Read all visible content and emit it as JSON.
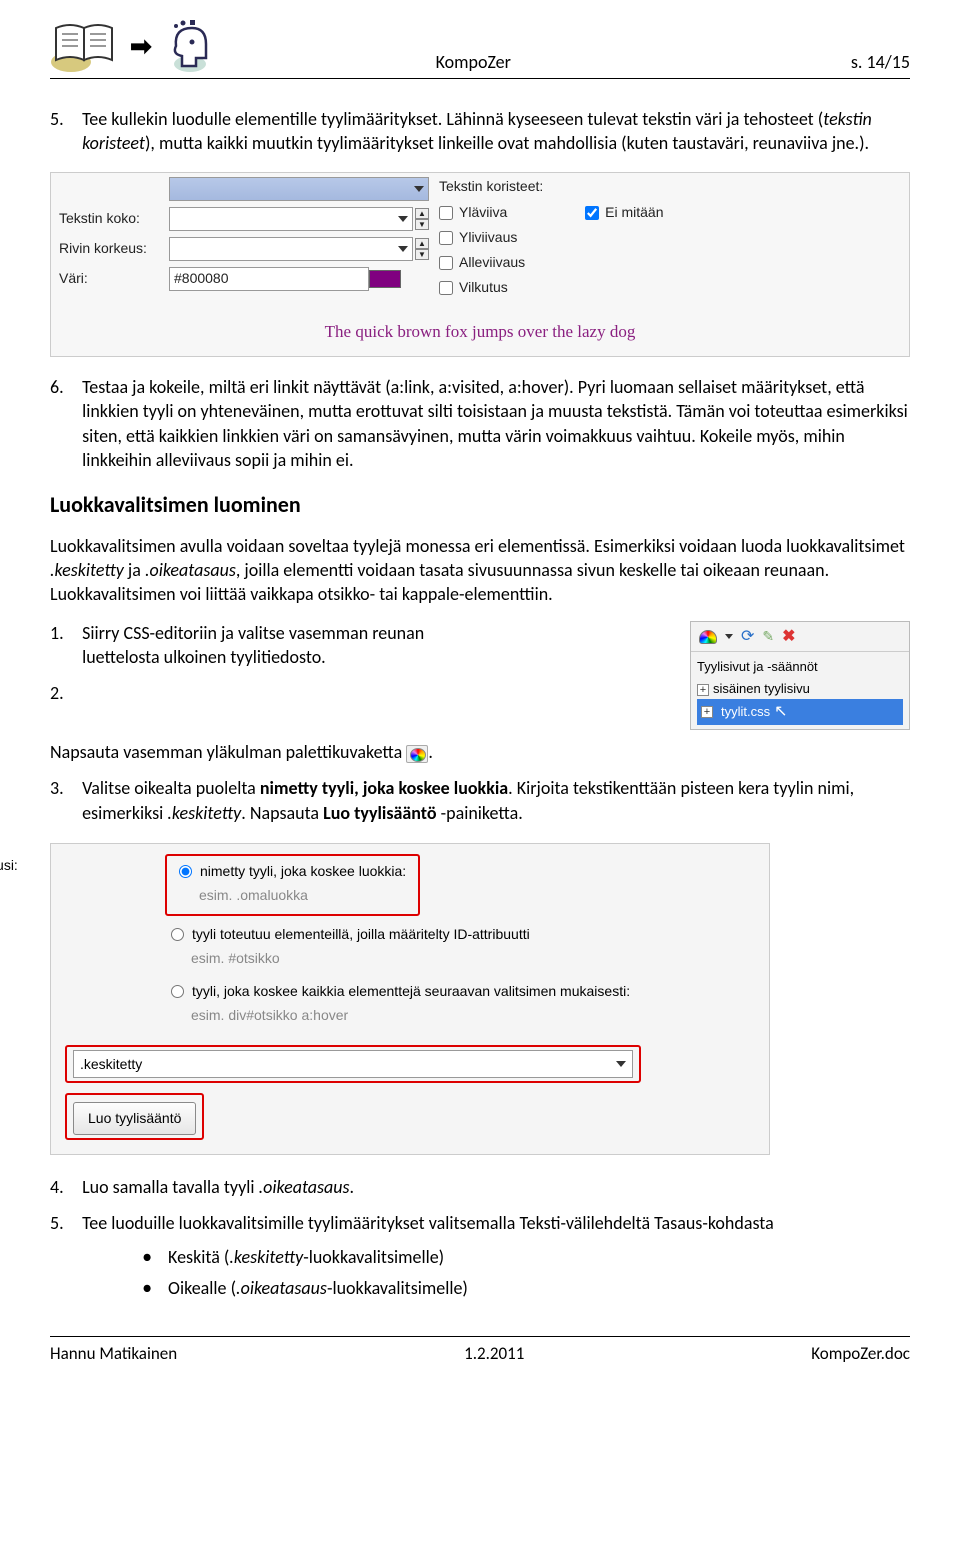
{
  "header": {
    "center": "KompoZer",
    "right": "s. 14/15"
  },
  "item5": {
    "num": "5.",
    "lead": "Tee kullekin luodulle elementille tyylimääritykset. Lähinnä kyseeseen tulevat tekstin väri ja tehosteet (",
    "ital1": "tekstin koristeet",
    "after1": "), mutta kaikki muutkin tyylimääritykset linkeille ovat mahdollisia (kuten taustaväri, reunaviiva jne.)."
  },
  "fig1": {
    "tekstin_koko": "Tekstin koko:",
    "rivin_korkeus": "Rivin korkeus:",
    "vari": "Väri:",
    "vari_val": "#800080",
    "rtitle": "Tekstin koristeet:",
    "opts": [
      "Yläviiva",
      "Yliviivaus",
      "Alleviivaus",
      "Vilkutus"
    ],
    "eimitaan": "Ei mitään",
    "preview": "The quick brown fox jumps over the lazy dog"
  },
  "item6": {
    "num": "6.",
    "text": "Testaa ja kokeile, miltä eri linkit näyttävät (a:link, a:visited, a:hover). Pyri luomaan sellaiset määritykset, että linkkien tyyli on yhteneväinen, mutta erottuvat silti toisistaan ja muusta tekstistä. Tämän voi toteuttaa esimerkiksi siten, että kaikkien linkkien väri on samansävyinen, mutta värin voimakkuus vaihtuu. Kokeile myös, mihin linkkeihin alleviivaus sopii ja mihin ei."
  },
  "h3": "Luokkavalitsimen luominen",
  "intro": {
    "p1a": "Luokkavalitsimen avulla voidaan soveltaa tyylejä monessa eri elementissä. Esimerkiksi voidaan luoda luokkavalitsimet ",
    "i1": ".keskitetty",
    "p1b": " ja ",
    "i2": ".oikeatasaus",
    "p1c": ", joilla elementti voidaan tasata sivusuunnassa sivun keskelle tai oikeaan reunaan. Luokkavalitsimen voi liittää vaikkapa otsikko- tai kappale-elementtiin."
  },
  "fig2": {
    "title": "Tyylisivut ja -säännöt",
    "line1": "sisäinen tyylisivu",
    "sel": "tyylit.css"
  },
  "step1": {
    "num": "1.",
    "text": "Siirry CSS-editoriin ja valitse vasemman reunan luettelosta ulkoinen tyylitiedosto."
  },
  "step2": {
    "num": "2.",
    "a": "Napsauta vasemman yläkulman palettikuvaketta ",
    "b": "."
  },
  "step3": {
    "num": "3.",
    "a": "Valitse oikealta puolelta ",
    "bold": "nimetty tyyli, joka koskee luokkia",
    "b": ". Kirjoita tekstikenttään pisteen kera tyylin nimi, esimerkiksi ",
    "ital": ".keskitetty",
    "c": ". Napsauta ",
    "bold2": "Luo tyylisääntö",
    "d": " -painiketta."
  },
  "fig3": {
    "luo": "Luo uusi:",
    "r1": "nimetty tyyli, joka koskee luokkia:",
    "h1": "esim. .omaluokka",
    "r2": "tyyli toteutuu elementeillä, joilla määritelty ID-attribuutti",
    "h2": "esim. #otsikko",
    "r3": "tyyli, joka koskee kaikkia elementtejä seuraavan valitsimen mukaisesti:",
    "h3": "esim. div#otsikko a:hover",
    "input": ".keskitetty",
    "btn": "Luo tyylisääntö"
  },
  "step4": {
    "num": "4.",
    "a": "Luo samalla tavalla tyyli ",
    "ital": ".oikeatasaus",
    "b": "."
  },
  "step5": {
    "num": "5.",
    "text": "Tee luoduille luokkavalitsimille tyylimääritykset valitsemalla Teksti-välilehdeltä Tasaus-kohdasta",
    "b1a": "Keskitä (",
    "b1i": ".keskitetty",
    "b1b": "-luokkavalitsimelle)",
    "b2a": "Oikealle (",
    "b2i": ".oikeatasaus",
    "b2b": "-luokkavalitsimelle)"
  },
  "footer": {
    "left": "Hannu Matikainen",
    "center": "1.2.2011",
    "right": "KompoZer.doc"
  }
}
